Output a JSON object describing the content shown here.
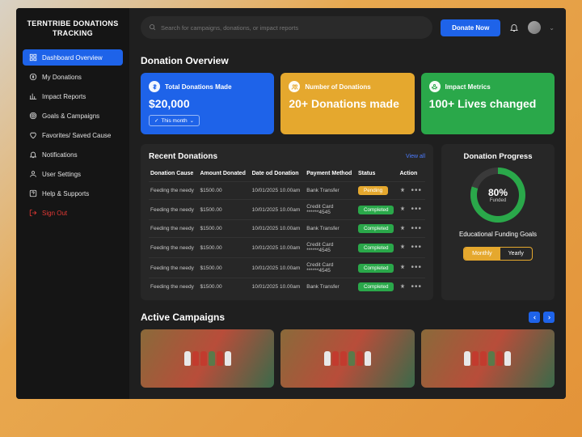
{
  "brand": "TERNTRIBE DONATIONS TRACKING",
  "search": {
    "placeholder": "Search for campaigns, donations, or impact reports"
  },
  "topbar": {
    "donate": "Donate Now"
  },
  "nav": {
    "dashboard": "Dashboard Overview",
    "donations": "My Donations",
    "impact": "Impact Reports",
    "goals": "Goals & Campaigns",
    "favorites": "Favorites/ Saved Cause",
    "notifications": "Notifications",
    "settings": "User Settings",
    "help": "Help & Supports",
    "signout": "Sign Out"
  },
  "overview": {
    "title": "Donation Overview",
    "card1": {
      "label": "Total Donations Made",
      "value": "$20,000",
      "period": "This month"
    },
    "card2": {
      "label": "Number of Donations",
      "value": "20+ Donations made"
    },
    "card3": {
      "label": "Impact Metrics",
      "value": "100+ Lives changed"
    }
  },
  "recent": {
    "title": "Recent Donations",
    "view_all": "View all",
    "cols": {
      "cause": "Donation Cause",
      "amount": "Amount Donated",
      "date": "Date od Donation",
      "method": "Payment Method",
      "status": "Status",
      "action": "Action"
    },
    "rows": [
      {
        "cause": "Feeding the needy",
        "amount": "$1500.00",
        "date": "10/01/2025 10.00am",
        "method": "Bank Transfer",
        "status": "Pending"
      },
      {
        "cause": "Feeding the needy",
        "amount": "$1500.00",
        "date": "10/01/2025 10.00am",
        "method": "Credit Card ******4545",
        "status": "Completed"
      },
      {
        "cause": "Feeding the needy",
        "amount": "$1500.00",
        "date": "10/01/2025 10.00am",
        "method": "Bank Transfer",
        "status": "Completed"
      },
      {
        "cause": "Feeding the needy",
        "amount": "$1500.00",
        "date": "10/01/2025 10.00am",
        "method": "Credit Card ******4545",
        "status": "Completed"
      },
      {
        "cause": "Feeding the needy",
        "amount": "$1500.00",
        "date": "10/01/2025 10.00am",
        "method": "Credit Card ******4545",
        "status": "Completed"
      },
      {
        "cause": "Feeding the needy",
        "amount": "$1500.00",
        "date": "10/01/2025 10.00am",
        "method": "Bank Transfer",
        "status": "Completed"
      }
    ]
  },
  "progress": {
    "title": "Donation Progress",
    "percent": "80%",
    "percent_label": "Funded",
    "goal": "Educational Funding Goals",
    "monthly": "Monthly",
    "yearly": "Yearly"
  },
  "campaigns": {
    "title": "Active Campaigns"
  }
}
